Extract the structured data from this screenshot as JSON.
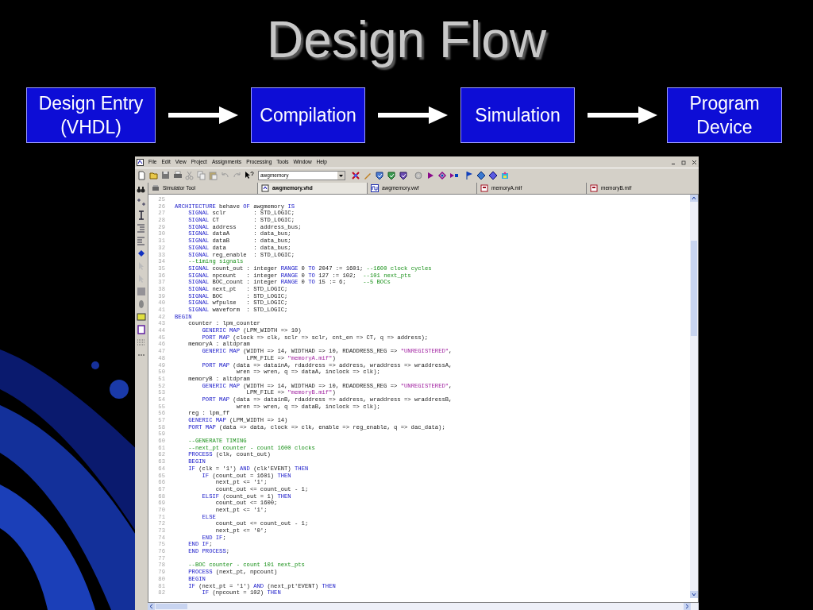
{
  "slide": {
    "title": "Design Flow",
    "flow_steps": [
      {
        "label": "Design Entry (VHDL)"
      },
      {
        "label": "Compilation"
      },
      {
        "label": "Simulation"
      },
      {
        "label": "Program Device"
      }
    ]
  },
  "window": {
    "menu": [
      "File",
      "Edit",
      "View",
      "Project",
      "Assignments",
      "Processing",
      "Tools",
      "Window",
      "Help"
    ],
    "project_dropdown": "awgmemory",
    "tabs": [
      {
        "label": "Simulator Tool",
        "kind": "tool",
        "selected": false
      },
      {
        "label": "awgmemory.vhd",
        "kind": "vhdl",
        "selected": true
      },
      {
        "label": "awgmemory.vwf",
        "kind": "waveform",
        "selected": false
      },
      {
        "label": "memoryA.mif",
        "kind": "mif",
        "selected": false
      },
      {
        "label": "memoryB.mif",
        "kind": "mif",
        "selected": false
      }
    ],
    "code_lines": [
      {
        "number": "25"
      },
      {
        "number": "26",
        "parts": [
          {
            "kind": "keyword",
            "text": "ARCHITECTURE"
          },
          {
            "kind": "plain",
            "text": " behave "
          },
          {
            "kind": "keyword",
            "text": "OF"
          },
          {
            "kind": "plain",
            "text": " awgmemory "
          },
          {
            "kind": "keyword",
            "text": "IS"
          }
        ]
      },
      {
        "number": "27",
        "parts": [
          {
            "kind": "keyword",
            "text": "    SIGNAL"
          },
          {
            "kind": "plain",
            "text": " sclr        : STD_LOGIC;"
          }
        ]
      },
      {
        "number": "28",
        "parts": [
          {
            "kind": "keyword",
            "text": "    SIGNAL"
          },
          {
            "kind": "plain",
            "text": " CT          : STD_LOGIC;"
          }
        ]
      },
      {
        "number": "29",
        "parts": [
          {
            "kind": "keyword",
            "text": "    SIGNAL"
          },
          {
            "kind": "plain",
            "text": " address     : address_bus;"
          }
        ]
      },
      {
        "number": "30",
        "parts": [
          {
            "kind": "keyword",
            "text": "    SIGNAL"
          },
          {
            "kind": "plain",
            "text": " dataA       : data_bus;"
          }
        ]
      },
      {
        "number": "31",
        "parts": [
          {
            "kind": "keyword",
            "text": "    SIGNAL"
          },
          {
            "kind": "plain",
            "text": " dataB       : data_bus;"
          }
        ]
      },
      {
        "number": "32",
        "parts": [
          {
            "kind": "keyword",
            "text": "    SIGNAL"
          },
          {
            "kind": "plain",
            "text": " data        : data_bus;"
          }
        ]
      },
      {
        "number": "33",
        "parts": [
          {
            "kind": "keyword",
            "text": "    SIGNAL"
          },
          {
            "kind": "plain",
            "text": " reg_enable  : STD_LOGIC;"
          }
        ]
      },
      {
        "number": "34",
        "parts": [
          {
            "kind": "comment",
            "text": "    --timing signals"
          }
        ]
      },
      {
        "number": "35",
        "parts": [
          {
            "kind": "keyword",
            "text": "    SIGNAL"
          },
          {
            "kind": "plain",
            "text": " count_out : integer "
          },
          {
            "kind": "keyword",
            "text": "RANGE"
          },
          {
            "kind": "plain",
            "text": " 0 "
          },
          {
            "kind": "keyword",
            "text": "TO"
          },
          {
            "kind": "plain",
            "text": " 2047 := 1601; "
          },
          {
            "kind": "comment",
            "text": "--1600 clock cycles"
          }
        ]
      },
      {
        "number": "36",
        "parts": [
          {
            "kind": "keyword",
            "text": "    SIGNAL"
          },
          {
            "kind": "plain",
            "text": " npcount   : integer "
          },
          {
            "kind": "keyword",
            "text": "RANGE"
          },
          {
            "kind": "plain",
            "text": " 0 "
          },
          {
            "kind": "keyword",
            "text": "TO"
          },
          {
            "kind": "plain",
            "text": " 127 := 102;  "
          },
          {
            "kind": "comment",
            "text": "--101 next_pts"
          }
        ]
      },
      {
        "number": "37",
        "parts": [
          {
            "kind": "keyword",
            "text": "    SIGNAL"
          },
          {
            "kind": "plain",
            "text": " BOC_count : integer "
          },
          {
            "kind": "keyword",
            "text": "RANGE"
          },
          {
            "kind": "plain",
            "text": " 0 "
          },
          {
            "kind": "keyword",
            "text": "TO"
          },
          {
            "kind": "plain",
            "text": " 15 := 6;     "
          },
          {
            "kind": "comment",
            "text": "--5 BOCs"
          }
        ]
      },
      {
        "number": "38",
        "parts": [
          {
            "kind": "keyword",
            "text": "    SIGNAL"
          },
          {
            "kind": "plain",
            "text": " next_pt   : STD_LOGIC;"
          }
        ]
      },
      {
        "number": "39",
        "parts": [
          {
            "kind": "keyword",
            "text": "    SIGNAL"
          },
          {
            "kind": "plain",
            "text": " BOC       : STD_LOGIC;"
          }
        ]
      },
      {
        "number": "40",
        "parts": [
          {
            "kind": "keyword",
            "text": "    SIGNAL"
          },
          {
            "kind": "plain",
            "text": " wfpulse   : STD_LOGIC;"
          }
        ]
      },
      {
        "number": "41",
        "parts": [
          {
            "kind": "keyword",
            "text": "    SIGNAL"
          },
          {
            "kind": "plain",
            "text": " waveform  : STD_LOGIC;"
          }
        ]
      },
      {
        "number": "42",
        "parts": [
          {
            "kind": "keyword",
            "text": "BEGIN"
          }
        ]
      },
      {
        "number": "43",
        "parts": [
          {
            "kind": "plain",
            "text": "    counter : lpm_counter"
          }
        ]
      },
      {
        "number": "44",
        "parts": [
          {
            "kind": "keyword",
            "text": "        GENERIC MAP"
          },
          {
            "kind": "plain",
            "text": " (LPM_WIDTH => 10)"
          }
        ]
      },
      {
        "number": "45",
        "parts": [
          {
            "kind": "keyword",
            "text": "        PORT MAP"
          },
          {
            "kind": "plain",
            "text": " (clock => clk, sclr => sclr, cnt_en => CT, q => address);"
          }
        ]
      },
      {
        "number": "46",
        "parts": [
          {
            "kind": "plain",
            "text": "    memoryA : altdpram"
          }
        ]
      },
      {
        "number": "47",
        "parts": [
          {
            "kind": "keyword",
            "text": "        GENERIC MAP"
          },
          {
            "kind": "plain",
            "text": " (WIDTH => 14, WIDTHAD => 10, RDADDRESS_REG => "
          },
          {
            "kind": "string",
            "text": "\"UNREGISTERED\""
          },
          {
            "kind": "plain",
            "text": ","
          }
        ]
      },
      {
        "number": "48",
        "parts": [
          {
            "kind": "plain",
            "text": "                     LPM_FILE => "
          },
          {
            "kind": "string",
            "text": "\"memoryA.mif\""
          },
          {
            "kind": "plain",
            "text": ")"
          }
        ]
      },
      {
        "number": "49",
        "parts": [
          {
            "kind": "keyword",
            "text": "        PORT MAP"
          },
          {
            "kind": "plain",
            "text": " (data => datainA, rdaddress => address, wraddress => wraddressA,"
          }
        ]
      },
      {
        "number": "50",
        "parts": [
          {
            "kind": "plain",
            "text": "                  wren => wren, q => dataA, inclock => clk);"
          }
        ]
      },
      {
        "number": "51",
        "parts": [
          {
            "kind": "plain",
            "text": "    memoryB : altdpram"
          }
        ]
      },
      {
        "number": "52",
        "parts": [
          {
            "kind": "keyword",
            "text": "        GENERIC MAP"
          },
          {
            "kind": "plain",
            "text": " (WIDTH => 14, WIDTHAD => 10, RDADDRESS_REG => "
          },
          {
            "kind": "string",
            "text": "\"UNREGISTERED\""
          },
          {
            "kind": "plain",
            "text": ","
          }
        ]
      },
      {
        "number": "53",
        "parts": [
          {
            "kind": "plain",
            "text": "                     LPM_FILE => "
          },
          {
            "kind": "string",
            "text": "\"memoryB.mif\""
          },
          {
            "kind": "plain",
            "text": ")"
          }
        ]
      },
      {
        "number": "54",
        "parts": [
          {
            "kind": "keyword",
            "text": "        PORT MAP"
          },
          {
            "kind": "plain",
            "text": " (data => datainB, rdaddress => address, wraddress => wraddressB,"
          }
        ]
      },
      {
        "number": "55",
        "parts": [
          {
            "kind": "plain",
            "text": "                  wren => wren, q => dataB, inclock => clk);"
          }
        ]
      },
      {
        "number": "56",
        "parts": [
          {
            "kind": "plain",
            "text": "    reg : lpm_ff"
          }
        ]
      },
      {
        "number": "57",
        "parts": [
          {
            "kind": "keyword",
            "text": "    GENERIC MAP"
          },
          {
            "kind": "plain",
            "text": " (LPM_WIDTH => 14)"
          }
        ]
      },
      {
        "number": "58",
        "parts": [
          {
            "kind": "keyword",
            "text": "    PORT MAP"
          },
          {
            "kind": "plain",
            "text": " (data => data, clock => clk, enable => reg_enable, q => dac_data);"
          }
        ]
      },
      {
        "number": "59"
      },
      {
        "number": "60",
        "parts": [
          {
            "kind": "comment",
            "text": "    --GENERATE TIMING"
          }
        ]
      },
      {
        "number": "61",
        "parts": [
          {
            "kind": "comment",
            "text": "    --next_pt counter - count 1600 clocks"
          }
        ]
      },
      {
        "number": "62",
        "parts": [
          {
            "kind": "keyword",
            "text": "    PROCESS"
          },
          {
            "kind": "plain",
            "text": " (clk, count_out)"
          }
        ]
      },
      {
        "number": "63",
        "parts": [
          {
            "kind": "keyword",
            "text": "    BEGIN"
          }
        ]
      },
      {
        "number": "64",
        "parts": [
          {
            "kind": "keyword",
            "text": "    IF"
          },
          {
            "kind": "plain",
            "text": " (clk = '1') "
          },
          {
            "kind": "keyword",
            "text": "AND"
          },
          {
            "kind": "plain",
            "text": " (clk'EVENT) "
          },
          {
            "kind": "keyword",
            "text": "THEN"
          }
        ]
      },
      {
        "number": "65",
        "parts": [
          {
            "kind": "keyword",
            "text": "        IF"
          },
          {
            "kind": "plain",
            "text": " (count_out = 1601) "
          },
          {
            "kind": "keyword",
            "text": "THEN"
          }
        ]
      },
      {
        "number": "66",
        "parts": [
          {
            "kind": "plain",
            "text": "            next_pt <= '1';"
          }
        ]
      },
      {
        "number": "67",
        "parts": [
          {
            "kind": "plain",
            "text": "            count_out <= count_out - 1;"
          }
        ]
      },
      {
        "number": "68",
        "parts": [
          {
            "kind": "keyword",
            "text": "        ELSIF"
          },
          {
            "kind": "plain",
            "text": " (count_out = 1) "
          },
          {
            "kind": "keyword",
            "text": "THEN"
          }
        ]
      },
      {
        "number": "69",
        "parts": [
          {
            "kind": "plain",
            "text": "            count_out <= 1600;"
          }
        ]
      },
      {
        "number": "70",
        "parts": [
          {
            "kind": "plain",
            "text": "            next_pt <= '1';"
          }
        ]
      },
      {
        "number": "71",
        "parts": [
          {
            "kind": "keyword",
            "text": "        ELSE"
          }
        ]
      },
      {
        "number": "72",
        "parts": [
          {
            "kind": "plain",
            "text": "            count_out <= count_out - 1;"
          }
        ]
      },
      {
        "number": "73",
        "parts": [
          {
            "kind": "plain",
            "text": "            next_pt <= '0';"
          }
        ]
      },
      {
        "number": "74",
        "parts": [
          {
            "kind": "keyword",
            "text": "        END IF"
          },
          {
            "kind": "plain",
            "text": ";"
          }
        ]
      },
      {
        "number": "75",
        "parts": [
          {
            "kind": "keyword",
            "text": "    END IF"
          },
          {
            "kind": "plain",
            "text": ";"
          }
        ]
      },
      {
        "number": "76",
        "parts": [
          {
            "kind": "keyword",
            "text": "    END PROCESS"
          },
          {
            "kind": "plain",
            "text": ";"
          }
        ]
      },
      {
        "number": "77"
      },
      {
        "number": "78",
        "parts": [
          {
            "kind": "comment",
            "text": "    --BOC counter - count 101 next_pts"
          }
        ]
      },
      {
        "number": "79",
        "parts": [
          {
            "kind": "keyword",
            "text": "    PROCESS"
          },
          {
            "kind": "plain",
            "text": " (next_pt, npcount)"
          }
        ]
      },
      {
        "number": "80",
        "parts": [
          {
            "kind": "keyword",
            "text": "    BEGIN"
          }
        ]
      },
      {
        "number": "81",
        "parts": [
          {
            "kind": "keyword",
            "text": "    IF"
          },
          {
            "kind": "plain",
            "text": " (next_pt = '1') "
          },
          {
            "kind": "keyword",
            "text": "AND"
          },
          {
            "kind": "plain",
            "text": " (next_pt'EVENT) "
          },
          {
            "kind": "keyword",
            "text": "THEN"
          }
        ]
      },
      {
        "number": "82",
        "parts": [
          {
            "kind": "keyword",
            "text": "        IF"
          },
          {
            "kind": "plain",
            "text": " (npcount = 102) "
          },
          {
            "kind": "keyword",
            "text": "THEN"
          }
        ]
      }
    ]
  }
}
